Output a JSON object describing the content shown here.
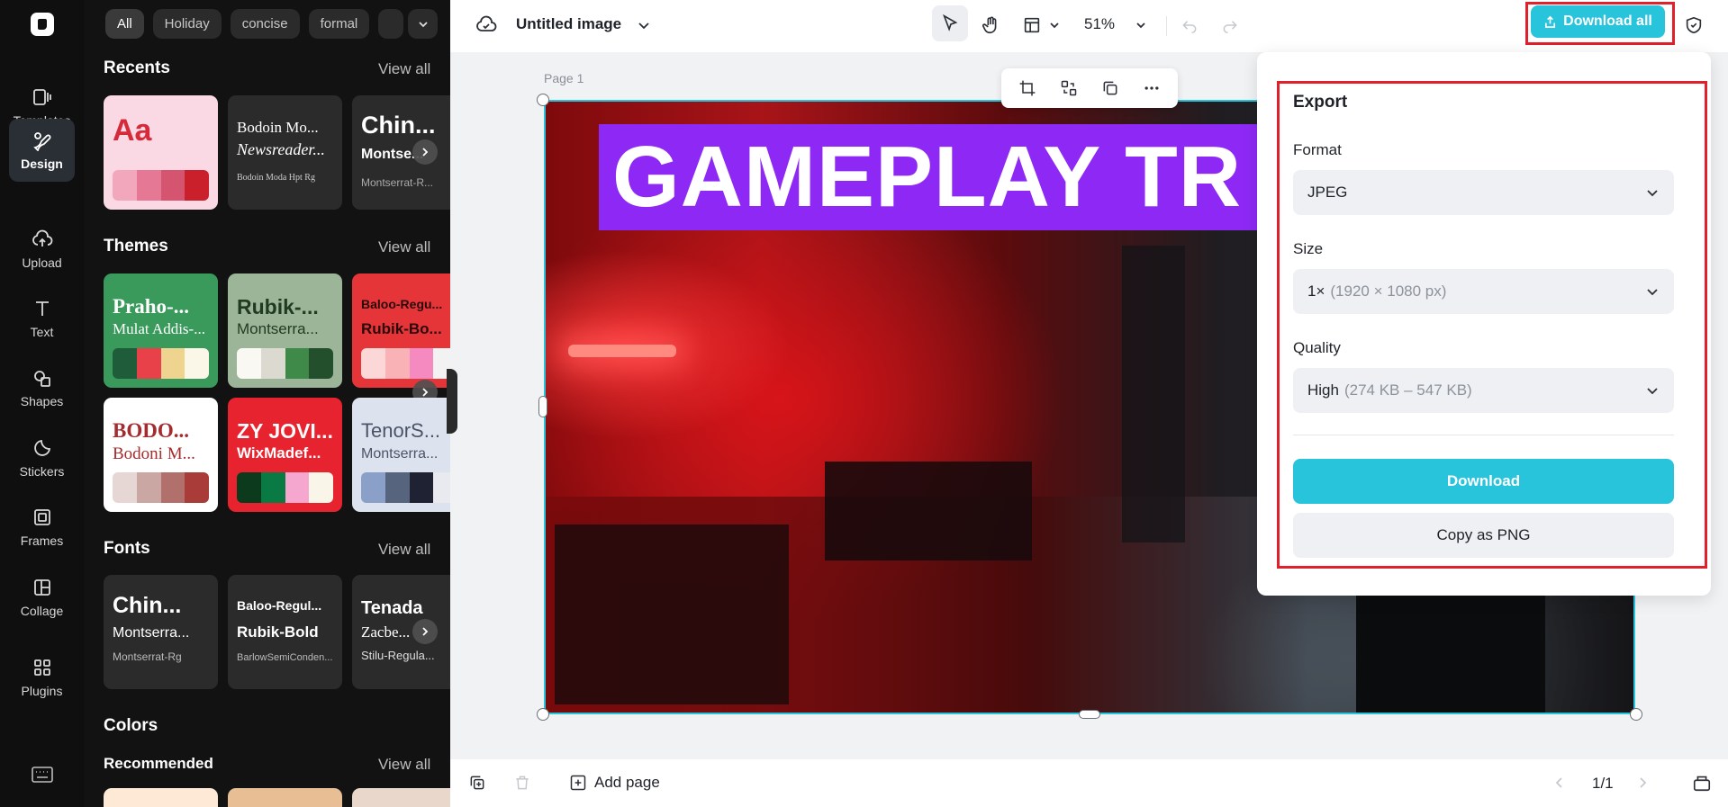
{
  "rail": {
    "items": [
      {
        "label": "Templates",
        "icon": "templates-icon"
      },
      {
        "label": "Design",
        "icon": "design-icon",
        "active": true
      },
      {
        "label": "Upload",
        "icon": "upload-icon"
      },
      {
        "label": "Text",
        "icon": "text-icon"
      },
      {
        "label": "Shapes",
        "icon": "shapes-icon"
      },
      {
        "label": "Stickers",
        "icon": "stickers-icon"
      },
      {
        "label": "Frames",
        "icon": "frames-icon"
      },
      {
        "label": "Collage",
        "icon": "collage-icon"
      },
      {
        "label": "Plugins",
        "icon": "plugins-icon"
      }
    ]
  },
  "panel": {
    "chips": [
      "All",
      "Holiday",
      "concise",
      "formal"
    ],
    "recents": {
      "title": "Recents",
      "view_all": "View all",
      "cards": [
        {
          "l1": "Aa"
        },
        {
          "l1": "Bodoin Mo...",
          "l2": "Newsreader...",
          "l3": "Bodoin Moda Hpt Rg"
        },
        {
          "l1": "Chin...",
          "l2": "Montse...",
          "l3": "Montserrat-R..."
        }
      ]
    },
    "themes": {
      "title": "Themes",
      "view_all": "View all",
      "cards": [
        {
          "l1": "Praho-...",
          "l2": "Mulat Addis-...",
          "colors": [
            "#1e5c3a",
            "#e8414a",
            "#efd490",
            "#faf6e8"
          ]
        },
        {
          "l1": "Rubik-...",
          "l2": "Montserra...",
          "colors": [
            "#faf8f2",
            "#dcdad0",
            "#3f8a49",
            "#234f2c"
          ]
        },
        {
          "l1": "Baloo-Regu...",
          "l2": "Rubik-Bo...",
          "colors": [
            "#fcd7d8",
            "#f9b3b6",
            "#f58ac0",
            "#f2f2f2"
          ]
        },
        {
          "l1": "BODO...",
          "l2": "Bodoni M...",
          "colors": [
            "#e6d7d4",
            "#cba7a3",
            "#b1706b",
            "#a93b39"
          ]
        },
        {
          "l1": "ZY JOVI...",
          "l2": "WixMadef...",
          "colors": [
            "#0b3b1c",
            "#0a7a45",
            "#f6a7d0",
            "#faf5e9"
          ]
        },
        {
          "l1": "TenorS...",
          "l2": "Montserra...",
          "colors": [
            "#8aa0c9",
            "#56647d",
            "#1f2233",
            "#e8eaf0"
          ]
        }
      ]
    },
    "fonts": {
      "title": "Fonts",
      "view_all": "View all",
      "cards": [
        {
          "l1": "Chin...",
          "l2": "Montserra...",
          "l3": "Montserrat-Rg"
        },
        {
          "l1": "Baloo-Regul...",
          "l2": "Rubik-Bold",
          "l3": "BarlowSemiConden..."
        },
        {
          "l1": "Tenada",
          "l2": "Zacbe...",
          "l3": "Stilu-Regula..."
        }
      ]
    },
    "colors": {
      "title": "Colors",
      "recommended": "Recommended",
      "view_all": "View all"
    }
  },
  "topbar": {
    "doc_title": "Untitled image",
    "zoom": "51%",
    "download_all": "Download all"
  },
  "canvas": {
    "page_label": "Page 1",
    "headline": "GAMEPLAY TR"
  },
  "export": {
    "title": "Export",
    "format_label": "Format",
    "format_value": "JPEG",
    "size_label": "Size",
    "size_value": "1×",
    "size_detail": "(1920 × 1080 px)",
    "quality_label": "Quality",
    "quality_value": "High",
    "quality_detail": "(274 KB – 547 KB)",
    "download": "Download",
    "copy_png": "Copy as PNG"
  },
  "bottombar": {
    "add_page": "Add page",
    "pages": "1/1"
  },
  "colors": {
    "accent": "#27c4dc",
    "highlight": "#e0202a",
    "headline_bg": "#8e29f5"
  }
}
